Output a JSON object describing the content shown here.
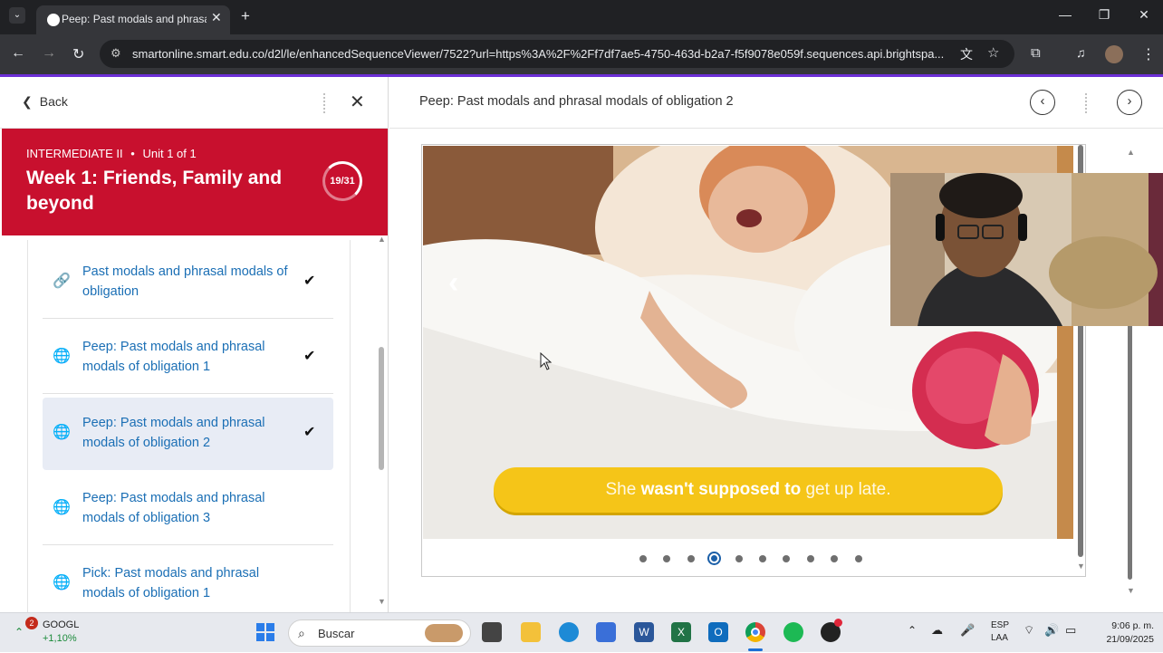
{
  "browser": {
    "tab_title": "Peep: Past modals and phrasal m",
    "url": "smartonline.smart.edu.co/d2l/le/enhancedSequenceViewer/7522?url=https%3A%2F%2Ff7df7ae5-4750-463d-b2a7-f5f9078e059f.sequences.api.brightspa..."
  },
  "left_panel": {
    "back_label": "Back",
    "course": {
      "level": "INTERMEDIATE II",
      "separator": "•",
      "unit": "Unit 1 of 1",
      "week_title": "Week 1: Friends, Family and beyond",
      "progress": "19/31"
    },
    "items": [
      {
        "label": "Past modals and phrasal modals of obligation",
        "icon": "link-icon",
        "completed": true,
        "active": false
      },
      {
        "label": "Peep: Past modals and phrasal modals of obligation 1",
        "icon": "globe-icon",
        "completed": true,
        "active": false
      },
      {
        "label": "Peep: Past modals and phrasal modals of obligation 2",
        "icon": "globe-icon",
        "completed": true,
        "active": true
      },
      {
        "label": "Peep: Past modals and phrasal modals of obligation 3",
        "icon": "globe-icon",
        "completed": false,
        "active": false
      },
      {
        "label": "Pick: Past modals and phrasal modals of obligation 1",
        "icon": "globe-icon",
        "completed": false,
        "active": false
      }
    ]
  },
  "right_panel": {
    "title": "Peep: Past modals and phrasal modals of obligation 2",
    "slide": {
      "caption_prefix": "She ",
      "caption_strong": "wasn't supposed to",
      "caption_suffix": " get up late.",
      "total_dots": 10,
      "current_dot": 4
    }
  },
  "taskbar": {
    "stock_name": "GOOGL",
    "stock_change": "+1,10%",
    "stock_badge": "2",
    "search_placeholder": "Buscar",
    "language": "ESP",
    "layout": "LAA",
    "time": "9:06 p. m.",
    "date": "21/09/2025"
  },
  "colors": {
    "course_header": "#c8102e",
    "link": "#1b6fb5",
    "caption_pill": "#f5c518",
    "accent_line": "#6d2fd6"
  }
}
